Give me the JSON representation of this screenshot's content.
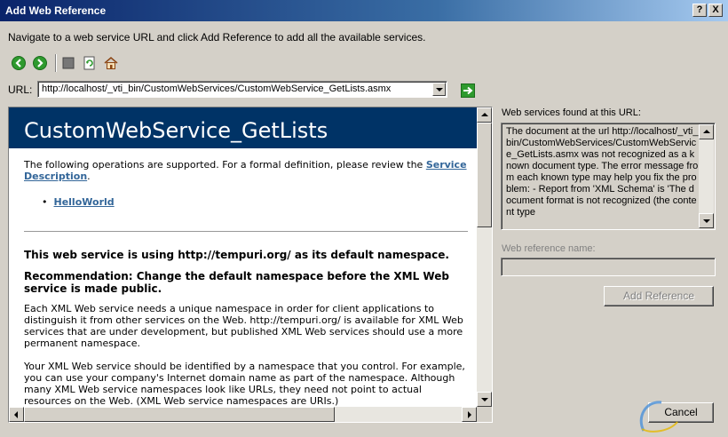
{
  "window": {
    "title": "Add Web Reference",
    "help_btn": "?",
    "close_btn": "X"
  },
  "instructions": "Navigate to a web service URL and click Add Reference to add all the available services.",
  "toolbar": {
    "icons": [
      "back-icon",
      "forward-icon",
      "stop-icon",
      "refresh-icon",
      "home-icon"
    ]
  },
  "url": {
    "label": "URL:",
    "value": "http://localhost/_vti_bin/CustomWebServices/CustomWebService_GetLists.asmx"
  },
  "page": {
    "heading": "CustomWebService_GetLists",
    "ops_intro": "The following operations are supported. For a formal definition, please review the",
    "service_description": "Service Description",
    "ops_intro_end": ".",
    "operations": [
      "HelloWorld"
    ],
    "bullet": "•",
    "ns_notice": "This web service is using http://tempuri.org/ as its default namespace.",
    "recommendation": "Recommendation: Change the default namespace before the XML Web service is made public.",
    "para1": "Each XML Web service needs a unique namespace in order for client applications to distinguish it from other services on the Web. http://tempuri.org/ is available for XML Web services that are under development, but published XML Web services should use a more permanent namespace.",
    "para2": "Your XML Web service should be identified by a namespace that you control. For example, you can use your company's Internet domain name as part of the namespace. Although many XML Web service namespaces look like URLs, they need not point to actual resources on the Web. (XML Web service namespaces are URIs.)"
  },
  "right_panel": {
    "found_label": "Web services found at this URL:",
    "found_text": "The document at the url http://localhost/_vti_bin/CustomWebServices/CustomWebService_GetLists.asmx was not recognized as a known document type. The error message from each known type may help you fix the problem: - Report from 'XML Schema' is 'The document format is not recognized (the content type",
    "refname_label": "Web reference name:",
    "refname_value": "",
    "add_reference": "Add Reference",
    "cancel": "Cancel"
  },
  "colors": {
    "title_start": "#0a246a",
    "heading_bg": "#003366",
    "link": "#336699",
    "dialog_bg": "#d4d0c8"
  }
}
